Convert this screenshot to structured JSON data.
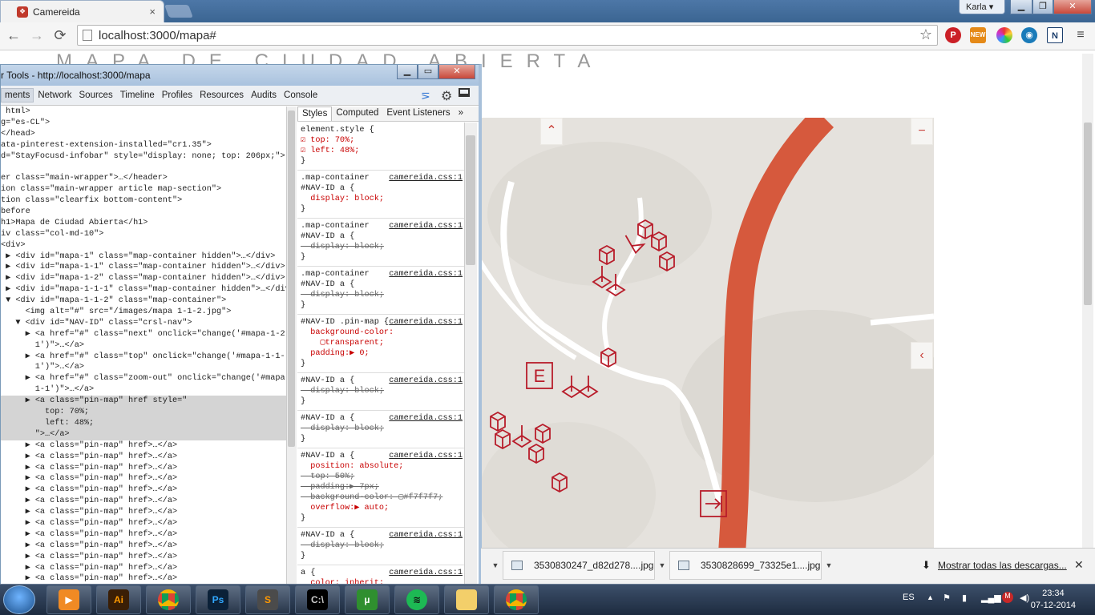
{
  "browser": {
    "tab_title": "Camereida",
    "tab_close": "×",
    "user_label": "Karla",
    "window_buttons": [
      "▁",
      "❐",
      "✕"
    ],
    "url": "localhost:3000/mapa#",
    "nav": {
      "back": "←",
      "forward": "→",
      "reload": "⟳"
    },
    "extensions": [
      "pinterest-icon",
      "new-extension-icon",
      "color-wheel-icon",
      "globe-icon",
      "n-extension-icon",
      "menu-icon"
    ],
    "ext_new_label": "NEW",
    "ext_n_label": "N"
  },
  "page": {
    "title": "MAPA DE CIUDAD ABIERTA",
    "map_controls": {
      "top": "⌃",
      "zoom_out": "−",
      "prev": "‹"
    },
    "map_letter": "E"
  },
  "devtools": {
    "window_title": "r Tools - http://localhost:3000/mapa",
    "window_buttons": [
      "▁",
      "▭",
      "✕"
    ],
    "tabs": [
      "ments",
      "Network",
      "Sources",
      "Timeline",
      "Profiles",
      "Resources",
      "Audits",
      "Console"
    ],
    "active_tab": "ments",
    "style_tabs": [
      "Styles",
      "Computed",
      "Event Listeners",
      "»"
    ],
    "elements_lines": [
      " html>",
      "g=\"es-CL\">",
      "</head>",
      "ata-pinterest-extension-installed=\"cr1.35\">",
      "d=\"StayFocusd-infobar\" style=\"display: none; top: 206px;\">",
      "",
      "er class=\"main-wrapper\">…</header>",
      "ion class=\"main-wrapper article map-section\">",
      "tion class=\"clearfix bottom-content\">",
      "before",
      "h1>Mapa de Ciudad Abierta</h1>",
      "iv class=\"col-md-10\">",
      "<div>",
      " ▶ <div id=\"mapa-1\" class=\"map-container hidden\">…</div>",
      " ▶ <div id=\"mapa-1-1\" class=\"map-container hidden\">…</div>",
      " ▶ <div id=\"mapa-1-2\" class=\"map-container hidden\">…</div>",
      " ▶ <div id=\"mapa-1-1-1\" class=\"map-container hidden\">…</div>",
      " ▼ <div id=\"mapa-1-1-2\" class=\"map-container\">",
      "     <img alt=\"#\" src=\"/images/mapa 1-1-2.jpg\">",
      "   ▼ <div id=\"NAV-ID\" class=\"crsl-nav\">",
      "     ▶ <a href=\"#\" class=\"next\" onclick=\"change('#mapa-1-2-",
      "       1')\">…</a>",
      "     ▶ <a href=\"#\" class=\"top\" onclick=\"change('#mapa-1-1-",
      "       1')\">…</a>",
      "     ▶ <a href=\"#\" class=\"zoom-out\" onclick=\"change('#mapa-",
      "       1-1')\">…</a>",
      "     ▶ <a class=\"pin-map\" href style=\"",
      "         top: 70%;",
      "         left: 48%;",
      "       \">…</a>",
      "     ▶ <a class=\"pin-map\" href>…</a>",
      "     ▶ <a class=\"pin-map\" href>…</a>",
      "     ▶ <a class=\"pin-map\" href>…</a>",
      "     ▶ <a class=\"pin-map\" href>…</a>",
      "     ▶ <a class=\"pin-map\" href>…</a>",
      "     ▶ <a class=\"pin-map\" href>…</a>",
      "     ▶ <a class=\"pin-map\" href>…</a>",
      "     ▶ <a class=\"pin-map\" href>…</a>",
      "     ▶ <a class=\"pin-map\" href>…</a>",
      "     ▶ <a class=\"pin-map\" href>…</a>",
      "     ▶ <a class=\"pin-map\" href>…</a>",
      "     ▶ <a class=\"pin-map\" href>…</a>",
      "     ▶ <a class=\"pin-map\" href>…</a>"
    ],
    "selected_line_index": 26,
    "styles": [
      {
        "selector": "element.style {",
        "src": "",
        "props": [
          {
            "t": "☑ top: 70%;",
            "s": false
          },
          {
            "t": "☑ left: 48%;",
            "s": false
          }
        ]
      },
      {
        "selector": ".map-container\n#NAV-ID a {",
        "src": "camereida.css:1",
        "props": [
          {
            "t": "  display: block;",
            "s": false
          }
        ]
      },
      {
        "selector": ".map-container\n#NAV-ID a {",
        "src": "camereida.css:1",
        "props": [
          {
            "t": "  display: block;",
            "s": true
          }
        ]
      },
      {
        "selector": ".map-container\n#NAV-ID a {",
        "src": "camereida.css:1",
        "props": [
          {
            "t": "  display: block;",
            "s": true
          }
        ]
      },
      {
        "selector": "#NAV-ID .pin-map {",
        "src": "camereida.css:1",
        "props": [
          {
            "t": "  background-color:\n    ▢transparent;",
            "s": false
          },
          {
            "t": "  padding:▶ 0;",
            "s": false
          }
        ]
      },
      {
        "selector": "#NAV-ID a {",
        "src": "camereida.css:1",
        "props": [
          {
            "t": "  display: block;",
            "s": true
          }
        ]
      },
      {
        "selector": "#NAV-ID a {",
        "src": "camereida.css:1",
        "props": [
          {
            "t": "  display: block;",
            "s": true
          }
        ]
      },
      {
        "selector": "#NAV-ID a {",
        "src": "camereida.css:1",
        "props": [
          {
            "t": "  position: absolute;",
            "s": false
          },
          {
            "t": "  top: 50%;",
            "s": true
          },
          {
            "t": "  padding:▶ 7px;",
            "s": true
          },
          {
            "t": "  background-color: ▢#f7f7f7;",
            "s": true
          },
          {
            "t": "  overflow:▶ auto;",
            "s": false
          }
        ]
      },
      {
        "selector": "#NAV-ID a {",
        "src": "camereida.css:1",
        "props": [
          {
            "t": "  display: block;",
            "s": true
          }
        ]
      },
      {
        "selector": "a {",
        "src": "camereida.css:1",
        "props": [
          {
            "t": "  color: inherit;",
            "s": false
          }
        ]
      }
    ]
  },
  "downloads": {
    "items": [
      "3530830247_d82d278....jpg",
      "3530828699_73325e1....jpg"
    ],
    "show_all": "Mostrar todas las descargas...",
    "close": "✕"
  },
  "taskbar": {
    "apps": [
      {
        "name": "media-player",
        "label": "▶",
        "color": "#f08a24",
        "fg": "#fff"
      },
      {
        "name": "illustrator",
        "label": "Ai",
        "color": "#3a1e05",
        "fg": "#ff9a00"
      },
      {
        "name": "chrome",
        "label": "",
        "color": "#e8e8e8",
        "fg": "#fff"
      },
      {
        "name": "photoshop",
        "label": "Ps",
        "color": "#0b2138",
        "fg": "#31a8ff"
      },
      {
        "name": "sublime",
        "label": "S",
        "color": "#4b4b4b",
        "fg": "#ff9800"
      },
      {
        "name": "cmd",
        "label": "C:\\",
        "color": "#000",
        "fg": "#ccc"
      },
      {
        "name": "utorrent",
        "label": "µ",
        "color": "#2f8f2f",
        "fg": "#fff"
      },
      {
        "name": "spotify",
        "label": "≋",
        "color": "#1db954",
        "fg": "#111"
      },
      {
        "name": "explorer",
        "label": "",
        "color": "#f3cf6a",
        "fg": "#333"
      },
      {
        "name": "chrome-active",
        "label": "",
        "color": "#e8e8e8",
        "fg": "#fff"
      }
    ],
    "language": "ES",
    "time": "23:34",
    "date": "07-12-2014"
  }
}
